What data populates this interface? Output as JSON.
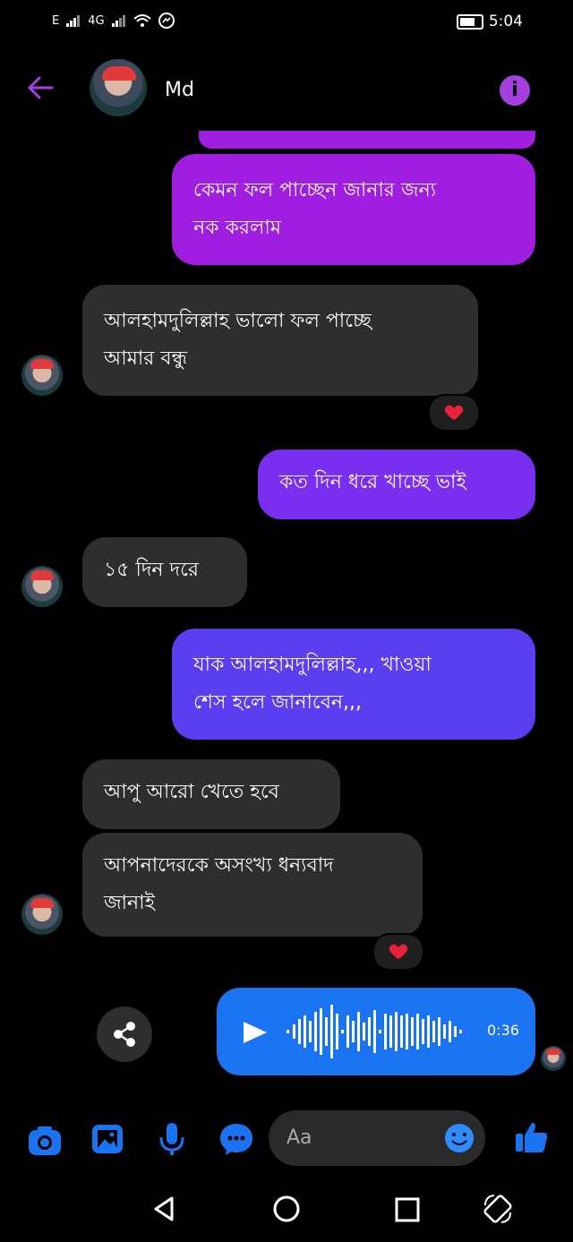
{
  "status_bar": {
    "network_e": "E",
    "network_4g": "4G",
    "time": "5:04"
  },
  "header": {
    "contact_name": "Md",
    "back_icon": "arrow-left-icon",
    "info_icon": "info-icon"
  },
  "messages": [
    {
      "direction": "out",
      "text_line1": "কেমন ফল পাচ্ছেন জানার জন্য",
      "text_line2": "নক করলাম"
    },
    {
      "direction": "in",
      "text_line1": "আলহামদুলিল্লাহ ভালো  ফল পাচ্ছে",
      "text_line2": "আমার বন্ধু",
      "reaction": "heart"
    },
    {
      "direction": "out",
      "text_line1": "কত দিন ধরে খাচ্ছে ভাই"
    },
    {
      "direction": "in",
      "text_line1": "১৫ দিন  দরে"
    },
    {
      "direction": "out",
      "text_line1": "যাক আলহামদুলিল্লাহ,,, খাওয়া",
      "text_line2": "শেস হলে জানাবেন,,,"
    },
    {
      "direction": "in",
      "text_line1": "আপু আরো খেতে হবে"
    },
    {
      "direction": "in",
      "text_line1": "আপনাদেরকে অসংখ্য ধন্যবাদ",
      "text_line2": "জানাই",
      "reaction": "heart"
    }
  ],
  "voice_message": {
    "duration": "0:36"
  },
  "composer": {
    "placeholder": "Aa"
  },
  "colors": {
    "accent_purple": "#a63fe0",
    "bubble_blue": "#1a73f0",
    "incoming_bg": "#2e2e2e"
  }
}
